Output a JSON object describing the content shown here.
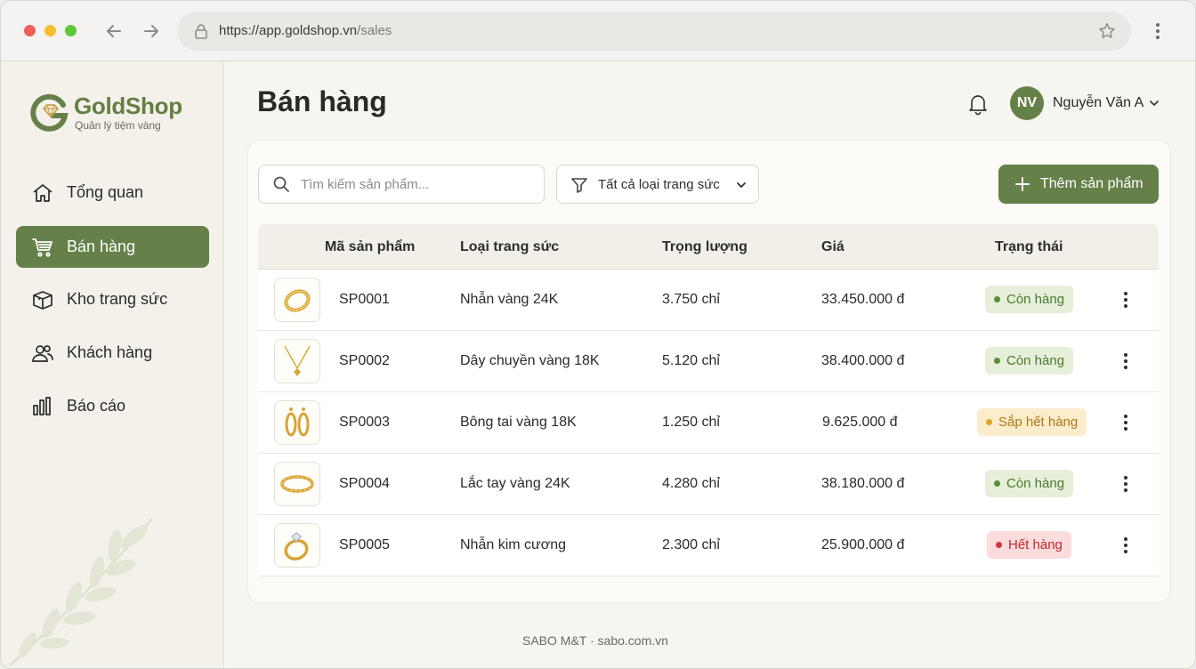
{
  "browser": {
    "url_host": "https://app.goldshop.vn",
    "url_path": "/sales"
  },
  "sidebar": {
    "brand": "GoldShop",
    "brand_sub": "Quản lý tiệm vàng",
    "items": [
      {
        "label": "Tổng quan",
        "icon": "home-icon"
      },
      {
        "label": "Bán hàng",
        "icon": "cart-icon",
        "active": true
      },
      {
        "label": "Kho trang sức",
        "icon": "box-icon"
      },
      {
        "label": "Khách hàng",
        "icon": "users-icon"
      },
      {
        "label": "Báo cáo",
        "icon": "bar-chart-icon"
      }
    ]
  },
  "header": {
    "title": "Bán hàng",
    "user_initials": "NV",
    "user_name": "Nguyễn Văn A"
  },
  "toolbar": {
    "search_placeholder": "Tìm kiếm sản phẩm...",
    "filter_label": "Tất cả loại trang sức",
    "add_label": "Thêm sản phẩm"
  },
  "table": {
    "columns": [
      "Mã sản phẩm",
      "Loại trang sức",
      "Trọng lượng",
      "Giá",
      "Trạng thái"
    ],
    "rows": [
      {
        "code": "SP0001",
        "type": "Nhẫn vàng 24K",
        "weight": "3.750 chỉ",
        "price": "33.450.000 đ",
        "status": "Còn hàng",
        "status_kind": "in-stock",
        "thumb": "ring-icon"
      },
      {
        "code": "SP0002",
        "type": "Dây chuyền vàng 18K",
        "weight": "5.120 chỉ",
        "price": "38.400.000 đ",
        "status": "Còn hàng",
        "status_kind": "in-stock",
        "thumb": "necklace-icon"
      },
      {
        "code": "SP0003",
        "type": "Bông tai vàng 18K",
        "weight": "1.250 chỉ",
        "price": "9.625.000 đ",
        "status": "Sắp hết hàng",
        "status_kind": "low-stock",
        "thumb": "earrings-icon"
      },
      {
        "code": "SP0004",
        "type": "Lắc tay vàng 24K",
        "weight": "4.280 chỉ",
        "price": "38.180.000 đ",
        "status": "Còn hàng",
        "status_kind": "in-stock",
        "thumb": "bracelet-icon"
      },
      {
        "code": "SP0005",
        "type": "Nhẫn kim cương",
        "weight": "2.300 chỉ",
        "price": "25.900.000 đ",
        "status": "Hết hàng",
        "status_kind": "out-of-stock",
        "thumb": "diamond-ring-icon"
      }
    ]
  },
  "footer": {
    "text": "SABO M&T · sabo.com.vn"
  },
  "colors": {
    "brand_green": "#66804a",
    "status_in_stock": "#5b8f37",
    "status_low_stock": "#e0a12b",
    "status_out_of_stock": "#d9353b"
  }
}
